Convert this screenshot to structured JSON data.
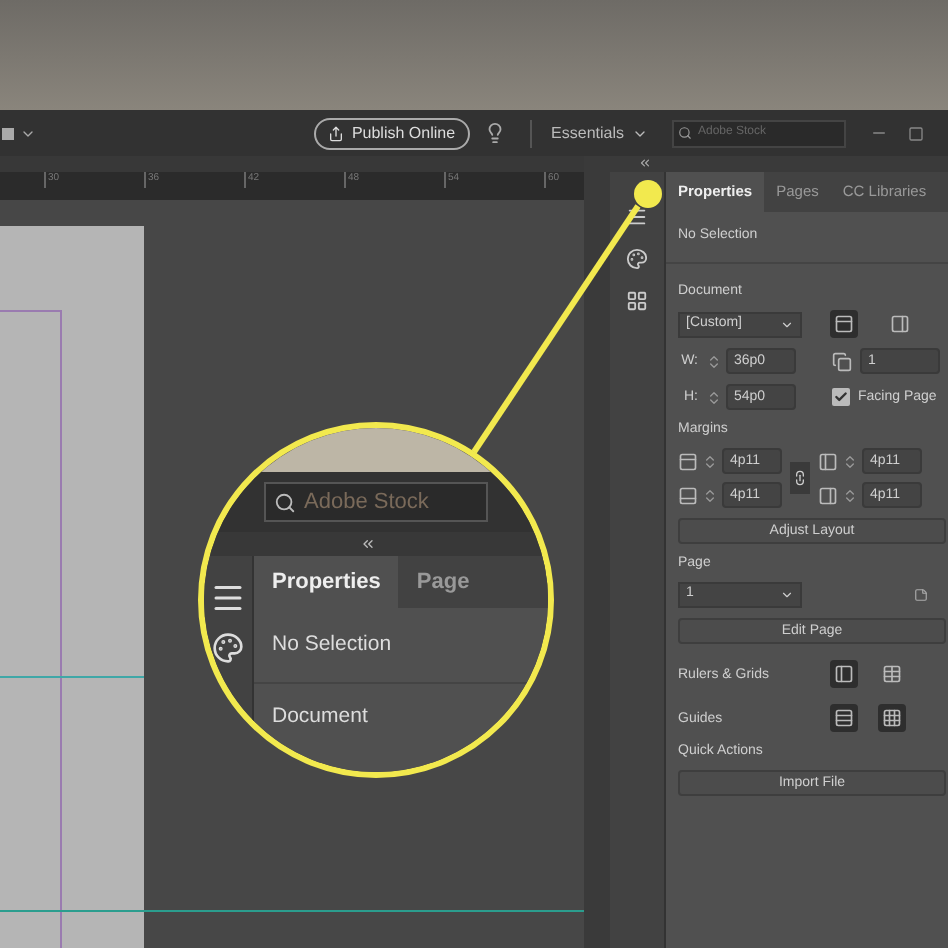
{
  "app_bar": {
    "publish_button": "Publish Online",
    "workspace": "Essentials",
    "search": {
      "placeholder": "Adobe Stock"
    }
  },
  "ruler": {
    "ticks": [
      "30",
      "36",
      "42",
      "48",
      "54",
      "60"
    ]
  },
  "panel": {
    "tabs": [
      {
        "label": "Properties",
        "selected": true
      },
      {
        "label": "Pages",
        "selected": false
      },
      {
        "label": "CC Libraries",
        "selected": false
      }
    ],
    "selection": "No Selection",
    "document": {
      "heading": "Document",
      "preset": "[Custom]",
      "width_label": "W:",
      "width": "36p0",
      "height_label": "H:",
      "height": "54p0",
      "pages": "1",
      "facing_pages": {
        "label": "Facing Page",
        "checked": true
      }
    },
    "margins": {
      "heading": "Margins",
      "values": [
        "4p11",
        "4p11",
        "4p11",
        "4p11"
      ]
    },
    "adjust_button": "Adjust Layout",
    "page": {
      "heading": "Page",
      "value": "1",
      "button": "Edit Page"
    },
    "rulers_heading": "Rulers & Grids",
    "guides_heading": "Guides",
    "quick_actions": {
      "heading": "Quick Actions",
      "button": "Import File"
    }
  },
  "callout": {
    "search_placeholder": "Adobe Stock",
    "tabs": [
      {
        "label": "Properties",
        "selected": true
      },
      {
        "label": "Page",
        "selected": false
      }
    ],
    "selection": "No Selection",
    "heading": "Document"
  }
}
